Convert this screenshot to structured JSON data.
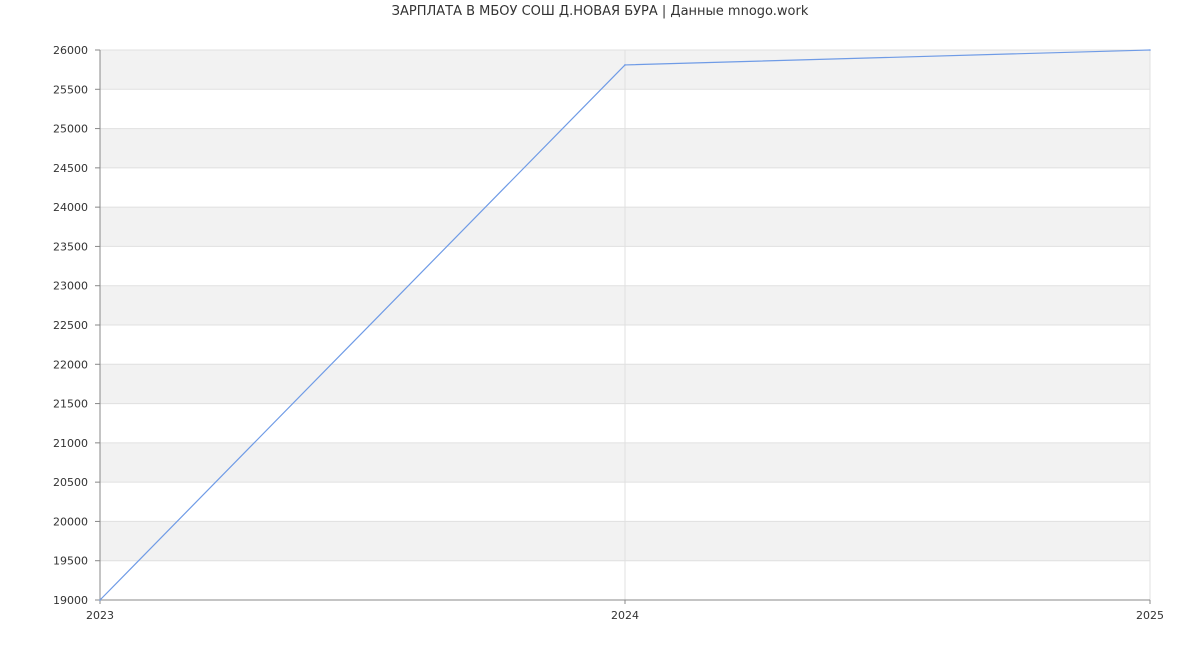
{
  "chart_data": {
    "type": "line",
    "title": "ЗАРПЛАТА В МБОУ СОШ Д.НОВАЯ БУРА | Данные mnogo.work",
    "xlabel": "",
    "ylabel": "",
    "x": [
      "2023",
      "2024",
      "2025"
    ],
    "series": [
      {
        "values": [
          19000,
          25810,
          26000
        ]
      }
    ],
    "ylim": [
      19000,
      26000
    ],
    "yticks": [
      19000,
      19500,
      20000,
      20500,
      21000,
      21500,
      22000,
      22500,
      23000,
      23500,
      24000,
      24500,
      25000,
      25500,
      26000
    ],
    "grid": true,
    "legend": "none",
    "colors": {
      "line": "#6f9be6",
      "band": "#f2f2f2",
      "grid": "#e0e0e0",
      "axis": "#888888"
    }
  }
}
